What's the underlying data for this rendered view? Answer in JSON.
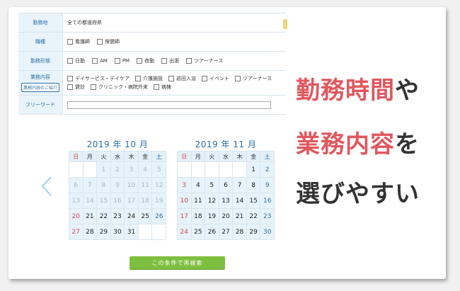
{
  "form": {
    "rows": [
      {
        "label": "勤務地",
        "value": "全ての都道府県"
      },
      {
        "label": "職種",
        "options": [
          "看護師",
          "保健師"
        ]
      },
      {
        "label": "勤務形態",
        "options": [
          "日勤",
          "AM",
          "PM",
          "夜勤",
          "出張",
          "ツアーナース"
        ]
      },
      {
        "label": "業務内容",
        "button": "業務内容のご紹介",
        "options": [
          "デイサービス・デイケア",
          "介護施設",
          "巡回入浴",
          "イベント",
          "ツアーナース",
          "健診",
          "クリニック・病院外来",
          "病棟"
        ]
      },
      {
        "label": "フリーワード"
      }
    ]
  },
  "calendar": {
    "weekdays": [
      "日",
      "月",
      "火",
      "水",
      "木",
      "金",
      "土"
    ],
    "months": [
      {
        "title": "2019 年 10 月",
        "weeks": [
          [
            "",
            "",
            "1",
            "2",
            "3",
            "4",
            "5"
          ],
          [
            "6",
            "7",
            "8",
            "9",
            "10",
            "11",
            "12"
          ],
          [
            "13",
            "14",
            "15",
            "16",
            "17",
            "18",
            "19"
          ],
          [
            "20",
            "21",
            "22",
            "23",
            "24",
            "25",
            "26"
          ],
          [
            "27",
            "28",
            "29",
            "30",
            "31",
            "",
            ""
          ]
        ],
        "past_until": 19
      },
      {
        "title": "2019 年 11 月",
        "weeks": [
          [
            "",
            "",
            "",
            "",
            "",
            "1",
            "2"
          ],
          [
            "3",
            "4",
            "5",
            "6",
            "7",
            "8",
            "9"
          ],
          [
            "10",
            "11",
            "12",
            "13",
            "14",
            "15",
            "16"
          ],
          [
            "17",
            "18",
            "19",
            "20",
            "21",
            "22",
            "23"
          ],
          [
            "24",
            "25",
            "26",
            "27",
            "28",
            "29",
            "30"
          ]
        ],
        "past_until": 0
      }
    ]
  },
  "search_button": "この条件で再検索",
  "caption": {
    "line1_red": "勤務時間",
    "line1_dark": "や",
    "line2_red": "業務内容",
    "line2_dark": "を",
    "line3": "選びやすい"
  },
  "colors": {
    "accent_red": "#e0585e",
    "calendar_blue": "#2a6fa6",
    "button_green": "#7fbf3f"
  },
  "icons": {
    "prev": "chevron-left-icon"
  }
}
